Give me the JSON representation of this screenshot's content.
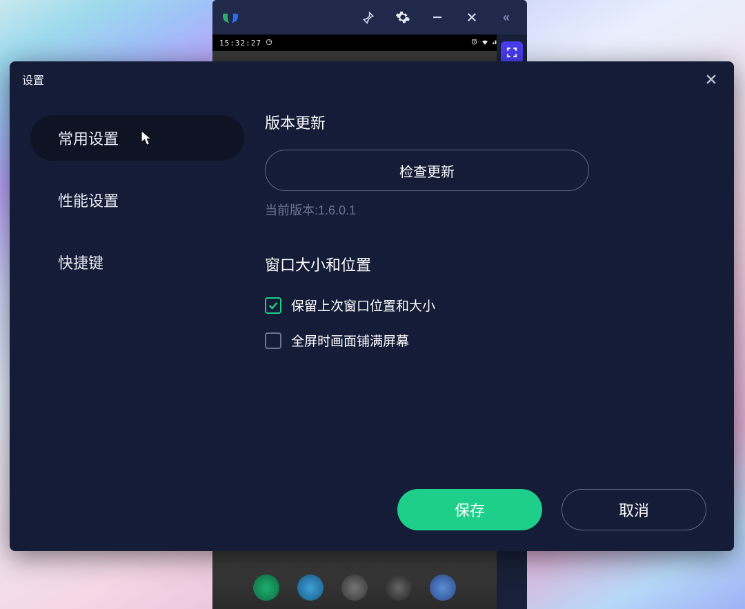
{
  "emulator": {
    "status_time": "15:32:27",
    "sidebar_collapse_glyph": "«"
  },
  "dialog": {
    "title": "设置",
    "nav": {
      "items": [
        {
          "label": "常用设置",
          "active": true
        },
        {
          "label": "性能设置",
          "active": false
        },
        {
          "label": "快捷键",
          "active": false
        }
      ]
    },
    "section_update": {
      "title": "版本更新",
      "check_button": "检查更新",
      "version_label": "当前版本:1.6.0.1"
    },
    "section_window": {
      "title": "窗口大小和位置",
      "keep_position_label": "保留上次窗口位置和大小",
      "keep_position_checked": true,
      "fullscreen_fill_label": "全屏时画面铺满屏幕",
      "fullscreen_fill_checked": false
    },
    "actions": {
      "save": "保存",
      "cancel": "取消"
    }
  },
  "colors": {
    "accent": "#1ecf8a",
    "dialog_bg": "#141c37"
  }
}
